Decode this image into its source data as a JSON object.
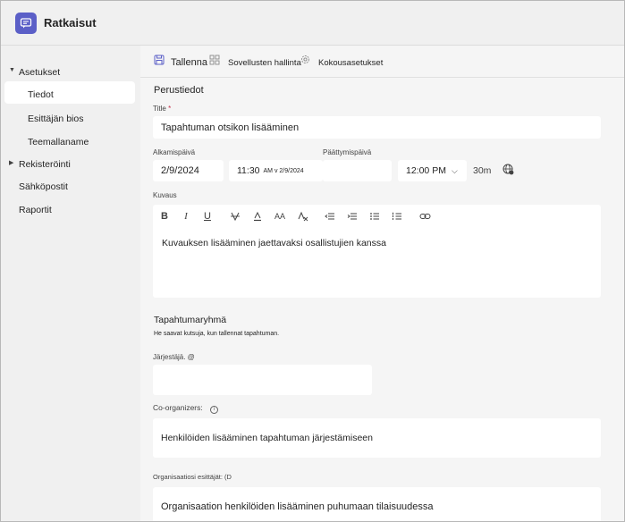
{
  "header": {
    "app_title": "Ratkaisut",
    "logo_icon": "teams-chat-icon",
    "accent": "#5b5fc7"
  },
  "sidebar": {
    "items": [
      {
        "label": "Asetukset",
        "expanded": true
      },
      {
        "label": "Tiedot",
        "selected": true
      },
      {
        "label": "Esittäjän bios"
      },
      {
        "label": "Teemallaname"
      },
      {
        "label": "Rekisteröinti",
        "expandable": true
      },
      {
        "label": "Sähköpostit"
      },
      {
        "label": "Raportit"
      }
    ]
  },
  "toolbar": {
    "save_label": "Tallenna",
    "apps_label": "Sovellusten hallinta",
    "settings_label": "Kokousasetukset"
  },
  "form": {
    "section_basic": "Perustiedot",
    "title_label": "Title",
    "title_required": "*",
    "title_value": "Tapahtuman otsikon lisääminen",
    "start_date_label": "Alkamispäivä",
    "start_date_value": "2/9/2024",
    "start_time_value": "11:30",
    "start_time_suffix": "AM v 2/9/2024",
    "end_date_label": "Päättymispäivä",
    "end_date_value": "",
    "end_time_value": "12:00 PM",
    "duration": "30m",
    "description_label": "Kuvaus",
    "description_value": "Kuvauksen lisääminen jaettavaksi osallistujien kanssa",
    "group_title": "Tapahtumaryhmä",
    "group_hint": "He saavat kutsuja, kun tallennat tapahtuman.",
    "organizer_label": "Järjestäjä. @",
    "organizer_value": "",
    "coorganizers_label": "Co-organizers:",
    "coorganizers_placeholder": "Henkilöiden lisääminen tapahtuman järjestämiseen",
    "presenters_label": "Organisaatiosi esittäjät: (D",
    "presenters_placeholder": "Organisaation henkilöiden lisääminen puhumaan tilaisuudessa"
  }
}
